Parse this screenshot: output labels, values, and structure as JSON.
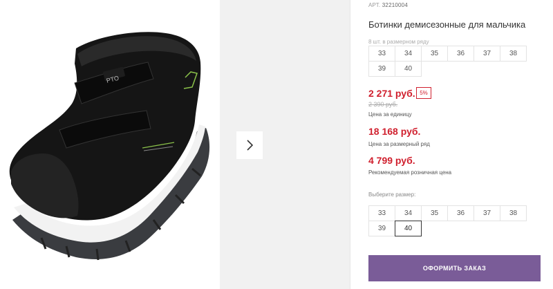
{
  "product": {
    "article_label": "АРТ.",
    "article_number": "32210004",
    "title": "Ботинки демисезонные для мальчика",
    "pack_note": "8 шт. в размерном ряду"
  },
  "gallery": {
    "image_alt": "black-boot-photo",
    "next_icon": "chevron-right-icon",
    "shoe_logo": "PTO"
  },
  "size_row": {
    "sizes": [
      "33",
      "34",
      "35",
      "36",
      "37",
      "38",
      "39",
      "40"
    ]
  },
  "pricing": {
    "unit_price": "2 271 руб.",
    "discount_badge": "5%",
    "old_price": "2 390 руб.",
    "unit_caption": "Цена за единицу",
    "row_price": "18 168 руб.",
    "row_caption": "Цена за размерный ряд",
    "rrp_price": "4 799 руб.",
    "rrp_caption": "Рекомендуемая розничная цена",
    "accent_color": "#d0202e"
  },
  "size_picker": {
    "label": "Выберите размер:",
    "sizes": [
      "33",
      "34",
      "35",
      "36",
      "37",
      "38",
      "39",
      "40"
    ],
    "selected": "40"
  },
  "order_button": {
    "label": "ОФОРМИТЬ ЗАКАЗ",
    "color": "#7a5c98"
  }
}
